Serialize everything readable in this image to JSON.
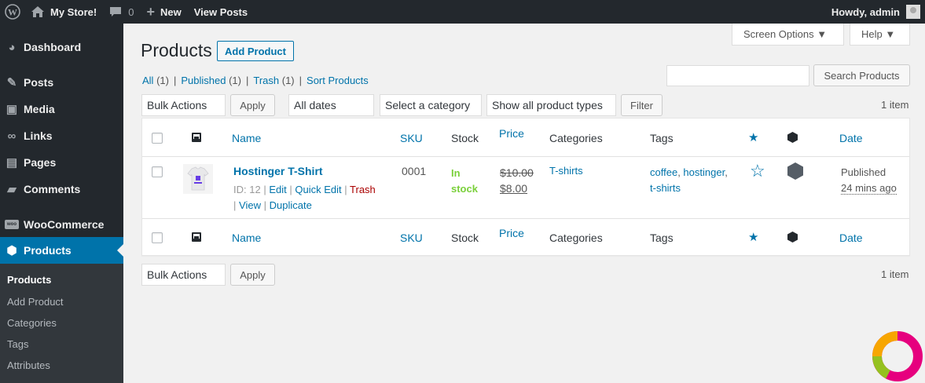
{
  "adminbar": {
    "site_name": "My Store!",
    "comments_count": "0",
    "new_label": "New",
    "view_posts_label": "View Posts",
    "howdy": "Howdy, admin"
  },
  "sidebar": {
    "items": [
      {
        "label": "Dashboard",
        "icon": "dashboard-icon"
      },
      {
        "label": "Posts",
        "icon": "pin-icon"
      },
      {
        "label": "Media",
        "icon": "media-icon"
      },
      {
        "label": "Links",
        "icon": "link-icon"
      },
      {
        "label": "Pages",
        "icon": "pages-icon"
      },
      {
        "label": "Comments",
        "icon": "comment-icon"
      },
      {
        "label": "WooCommerce",
        "icon": "woo-icon"
      },
      {
        "label": "Products",
        "icon": "box-icon"
      }
    ],
    "submenu": [
      "Products",
      "Add Product",
      "Categories",
      "Tags",
      "Attributes"
    ]
  },
  "header": {
    "title": "Products",
    "add_label": "Add Product",
    "screen_options": "Screen Options ▼",
    "help": "Help ▼"
  },
  "views": {
    "all": "All",
    "all_count": "(1)",
    "published": "Published",
    "published_count": "(1)",
    "trash": "Trash",
    "trash_count": "(1)",
    "sort": "Sort Products"
  },
  "search": {
    "button": "Search Products",
    "value": ""
  },
  "filters": {
    "bulk_actions": "Bulk Actions",
    "apply": "Apply",
    "dates": "All dates",
    "category": "Select a category",
    "product_type": "Show all product types",
    "filter": "Filter",
    "count": "1 item"
  },
  "table": {
    "columns": {
      "name": "Name",
      "sku": "SKU",
      "stock": "Stock",
      "price": "Price",
      "categories": "Categories",
      "tags": "Tags",
      "date": "Date"
    },
    "rows": [
      {
        "name": "Hostinger T-Shirt",
        "id": "ID: 12",
        "actions": {
          "edit": "Edit",
          "quick_edit": "Quick Edit",
          "trash": "Trash",
          "view": "View",
          "duplicate": "Duplicate"
        },
        "sku": "0001",
        "stock_line1": "In",
        "stock_line2": "stock",
        "price_regular": "$10.00",
        "price_sale": "$8.00",
        "category": "T-shirts",
        "tag1": "coffee",
        "tag2": "hostinger",
        "tag3": "t-shirts",
        "status": "Published",
        "time": "24 mins ago"
      }
    ]
  },
  "colors": {
    "accent": "#0073aa",
    "sidebar": "#23282d",
    "in_stock": "#7ad03a",
    "trash": "#a00"
  }
}
